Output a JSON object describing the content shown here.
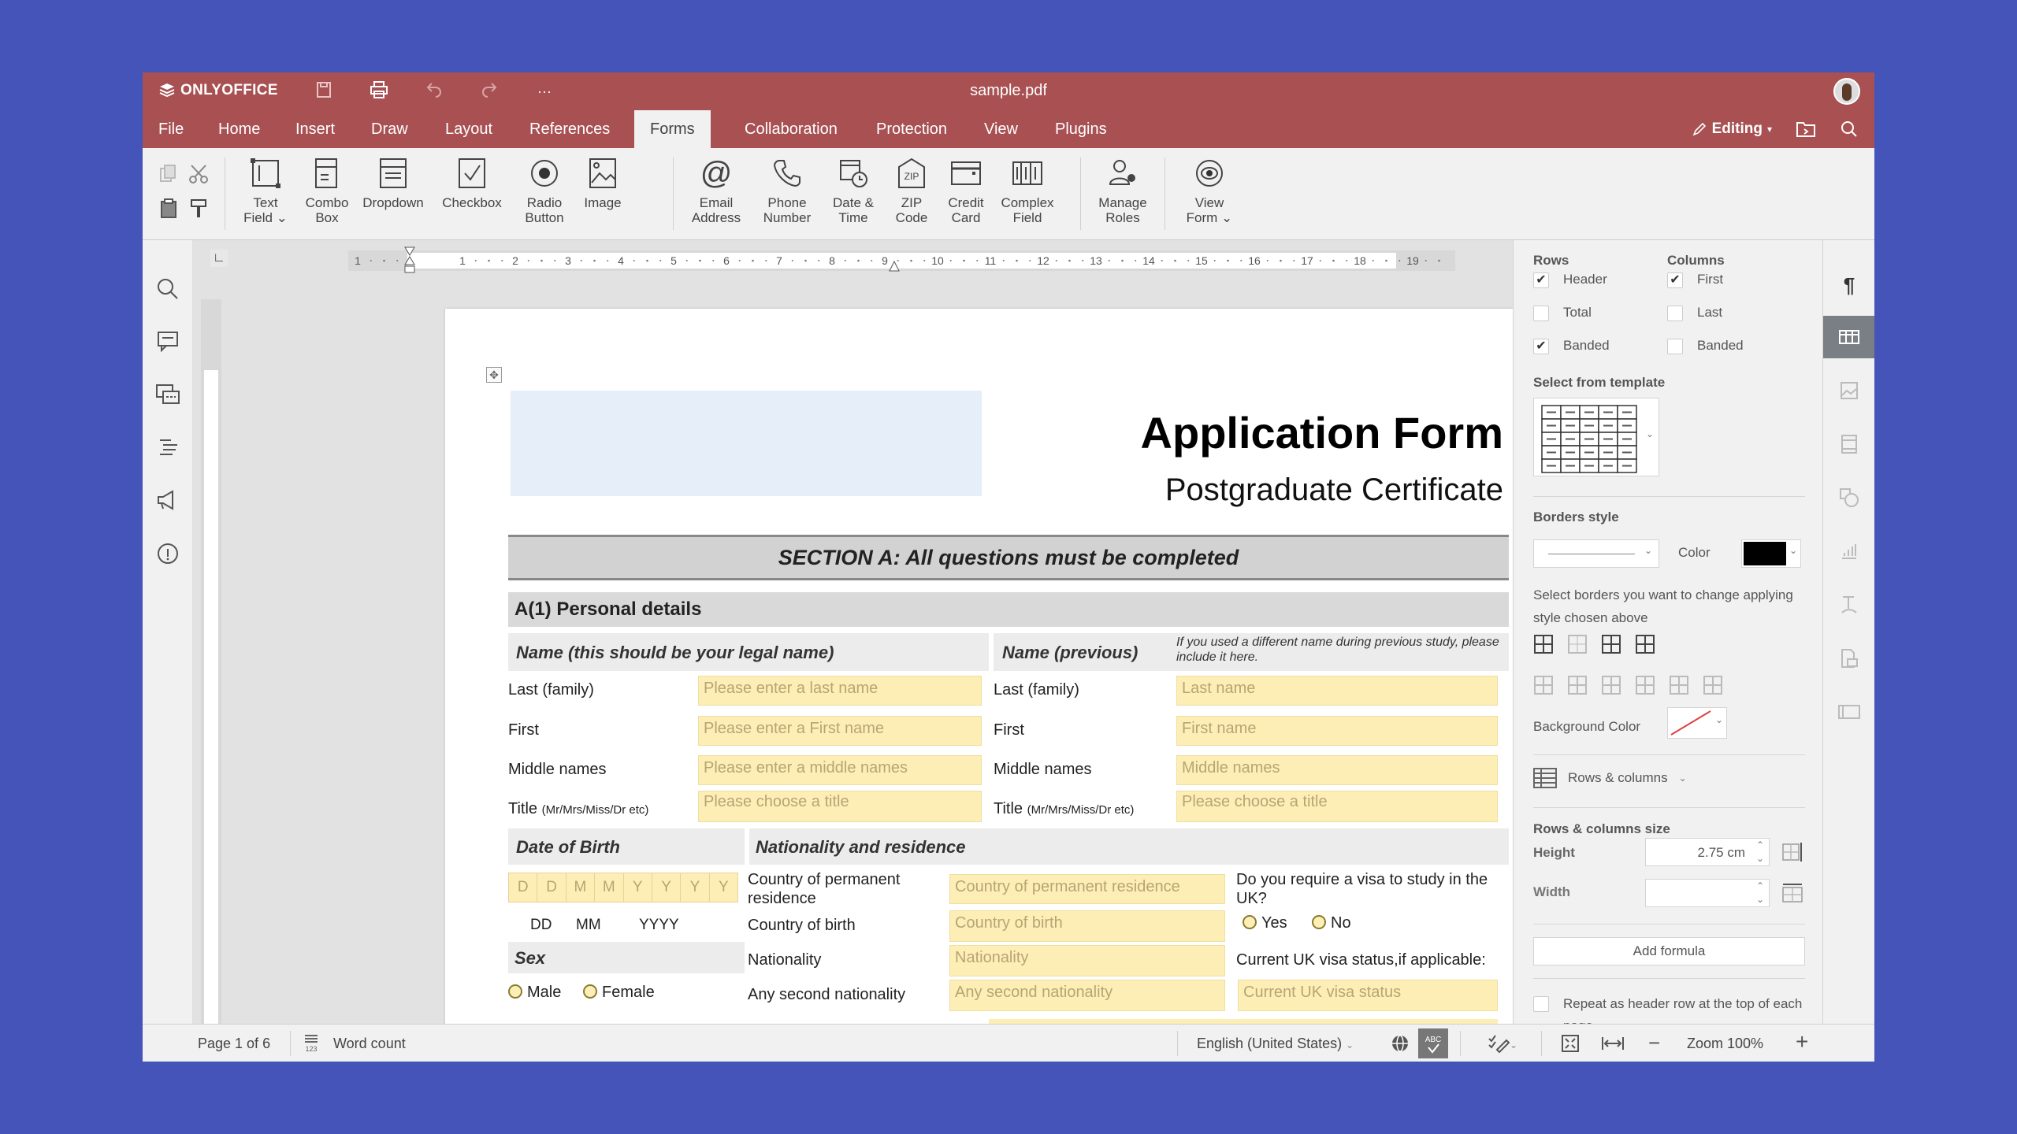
{
  "app": {
    "brand": "ONLYOFFICE",
    "doc_title": "sample.pdf"
  },
  "quick_access": [
    {
      "icon": "save-icon"
    },
    {
      "icon": "print-icon"
    },
    {
      "icon": "undo-icon"
    },
    {
      "icon": "redo-icon"
    },
    {
      "icon": "more-icon",
      "glyph": "···"
    }
  ],
  "tabs": [
    "File",
    "Home",
    "Insert",
    "Draw",
    "Layout",
    "References",
    "Forms",
    "Collaboration",
    "Protection",
    "View",
    "Plugins"
  ],
  "active_tab": "Forms",
  "header_right": {
    "mode_label": "Editing"
  },
  "toolbar": {
    "buttons": [
      {
        "id": "text-field",
        "label1": "Text",
        "label2": "Field ⌄"
      },
      {
        "id": "combo-box",
        "label1": "Combo",
        "label2": "Box"
      },
      {
        "id": "dropdown",
        "label1": "Dropdown",
        "label2": ""
      },
      {
        "id": "checkbox",
        "label1": "Checkbox",
        "label2": ""
      },
      {
        "id": "radio-button",
        "label1": "Radio",
        "label2": "Button"
      },
      {
        "id": "image",
        "label1": "Image",
        "label2": ""
      },
      {
        "id": "email-address",
        "label1": "Email",
        "label2": "Address"
      },
      {
        "id": "phone-number",
        "label1": "Phone",
        "label2": "Number"
      },
      {
        "id": "date-time",
        "label1": "Date &",
        "label2": "Time"
      },
      {
        "id": "zip-code",
        "label1": "ZIP",
        "label2": "Code"
      },
      {
        "id": "credit-card",
        "label1": "Credit",
        "label2": "Card"
      },
      {
        "id": "complex-field",
        "label1": "Complex",
        "label2": "Field"
      },
      {
        "id": "manage-roles",
        "label1": "Manage",
        "label2": "Roles"
      },
      {
        "id": "view-form",
        "label1": "View",
        "label2": "Form ⌄"
      }
    ]
  },
  "ruler": {
    "numbers": [
      "1",
      "1",
      "2",
      "3",
      "4",
      "5",
      "6",
      "7",
      "8",
      "9",
      "10",
      "11",
      "12",
      "13",
      "14",
      "15",
      "16",
      "17",
      "18",
      "19"
    ]
  },
  "document": {
    "title": "Application Form",
    "subtitle": "Postgraduate Certificate",
    "section_a": "SECTION A: All questions must be completed",
    "personal_details": "A(1) Personal details",
    "name_legal_header": "Name (this should be your legal name)",
    "name_prev_header": "Name (previous)",
    "name_prev_note": "If you used a different name during previous study, please include it here.",
    "legal_rows": [
      {
        "label": "Last (family)",
        "placeholder": "Please enter a last name"
      },
      {
        "label": "First",
        "placeholder": "Please enter a First name"
      },
      {
        "label": "Middle names",
        "placeholder": "Please enter a middle names"
      },
      {
        "label": "Title",
        "label_small": "(Mr/Mrs/Miss/Dr etc)",
        "placeholder": "Please choose a title"
      }
    ],
    "prev_rows": [
      {
        "label": "Last (family)",
        "placeholder": "Last name"
      },
      {
        "label": "First",
        "placeholder": "First name"
      },
      {
        "label": "Middle names",
        "placeholder": "Middle names"
      },
      {
        "label": "Title",
        "label_small": "(Mr/Mrs/Miss/Dr etc)",
        "placeholder": "Please choose a title"
      }
    ],
    "dob_header": "Date of Birth",
    "dob_cells": [
      "D",
      "D",
      "M",
      "M",
      "Y",
      "Y",
      "Y",
      "Y"
    ],
    "dob_legend": [
      "DD",
      "MM",
      "YYYY"
    ],
    "sex_header": "Sex",
    "sex_options": [
      "Male",
      "Female"
    ],
    "nationality_header": "Nationality and residence",
    "nationality_rows": [
      {
        "label": "Country of permanent residence",
        "placeholder": "Country of permanent residence"
      },
      {
        "label": "Country of birth",
        "placeholder": "Country of birth"
      },
      {
        "label": "Nationality",
        "placeholder": "Nationality"
      },
      {
        "label": "Any second nationality",
        "placeholder": "Any second nationality"
      }
    ],
    "visa_question": "Do you require a visa to study in the UK?",
    "visa_options": [
      "Yes",
      "No"
    ],
    "visa_status_label": "Current UK visa status,if applicable:",
    "visa_status_placeholder": "Current UK visa status"
  },
  "right_panel": {
    "rows_title": "Rows",
    "columns_title": "Columns",
    "rows": [
      {
        "label": "Header",
        "checked": true
      },
      {
        "label": "Total",
        "checked": false
      },
      {
        "label": "Banded",
        "checked": true
      }
    ],
    "columns": [
      {
        "label": "First",
        "checked": true
      },
      {
        "label": "Last",
        "checked": false
      },
      {
        "label": "Banded",
        "checked": false
      }
    ],
    "template_title": "Select from template",
    "borders_title": "Borders style",
    "color_label": "Color",
    "border_color": "#000000",
    "borders_hint": "Select borders you want to change applying style chosen above",
    "bg_color_label": "Background Color",
    "rows_columns_label": "Rows & columns",
    "size_title": "Rows & columns size",
    "height_label": "Height",
    "height_value": "2.75 cm",
    "width_label": "Width",
    "width_value": "",
    "add_formula": "Add formula",
    "repeat_header": "Repeat as header row at the top of each page",
    "repeat_checked": false
  },
  "status_bar": {
    "page": "Page 1 of 6",
    "word_count": "Word count",
    "language": "English (United States)",
    "zoom": "Zoom 100%"
  },
  "colors": {
    "header_bg": "#a85052",
    "form_field": "#fdeeb6",
    "background": "#4554b9"
  }
}
